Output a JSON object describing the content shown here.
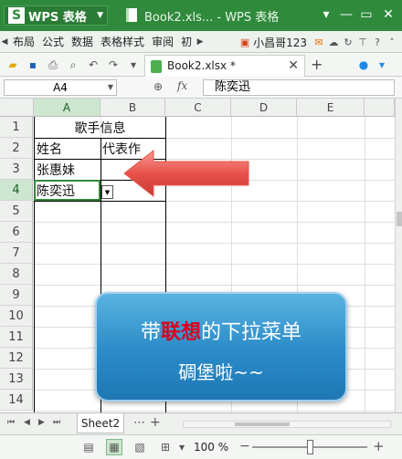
{
  "window": {
    "app_button": "WPS 表格",
    "app_logo": "S",
    "title": "Book2.xls... - WPS 表格"
  },
  "menubar": {
    "items": [
      "布局",
      "公式",
      "数据",
      "表格样式",
      "审阅",
      "初"
    ],
    "user": "小昌哥123"
  },
  "document_tab": {
    "label": "Book2.xlsx *"
  },
  "formula_bar": {
    "cell_ref": "A4",
    "fx": "fx",
    "content": "陈奕迅"
  },
  "columns": [
    "A",
    "B",
    "C",
    "D",
    "E"
  ],
  "rows": [
    "1",
    "2",
    "3",
    "4",
    "5",
    "6",
    "7",
    "8",
    "9",
    "10",
    "11",
    "12",
    "13",
    "14"
  ],
  "cells": {
    "A1": "歌手信息",
    "A2": "姓名",
    "B2": "代表作",
    "A3": "张惠妹",
    "A4": "陈奕迅"
  },
  "callout": {
    "pre": "带",
    "keyword": "联想",
    "post": "的下拉菜单",
    "line2": "碉堡啦~~"
  },
  "sheet_tabs": [
    "Sheet2"
  ],
  "statusbar": {
    "zoom": "100 %"
  },
  "colors": {
    "title_green": "#2f8a3c",
    "selection_green": "#2f8a3c",
    "callout_blue": "#2a8bc8",
    "keyword_red": "#d9001b",
    "arrow_red": "#e8524a"
  },
  "icons": [
    "minimize-icon",
    "maximize-icon",
    "close-icon",
    "open-folder-icon",
    "save-icon",
    "print-icon",
    "undo-icon",
    "redo-icon",
    "zoom-icon",
    "scroll-left-icon"
  ]
}
